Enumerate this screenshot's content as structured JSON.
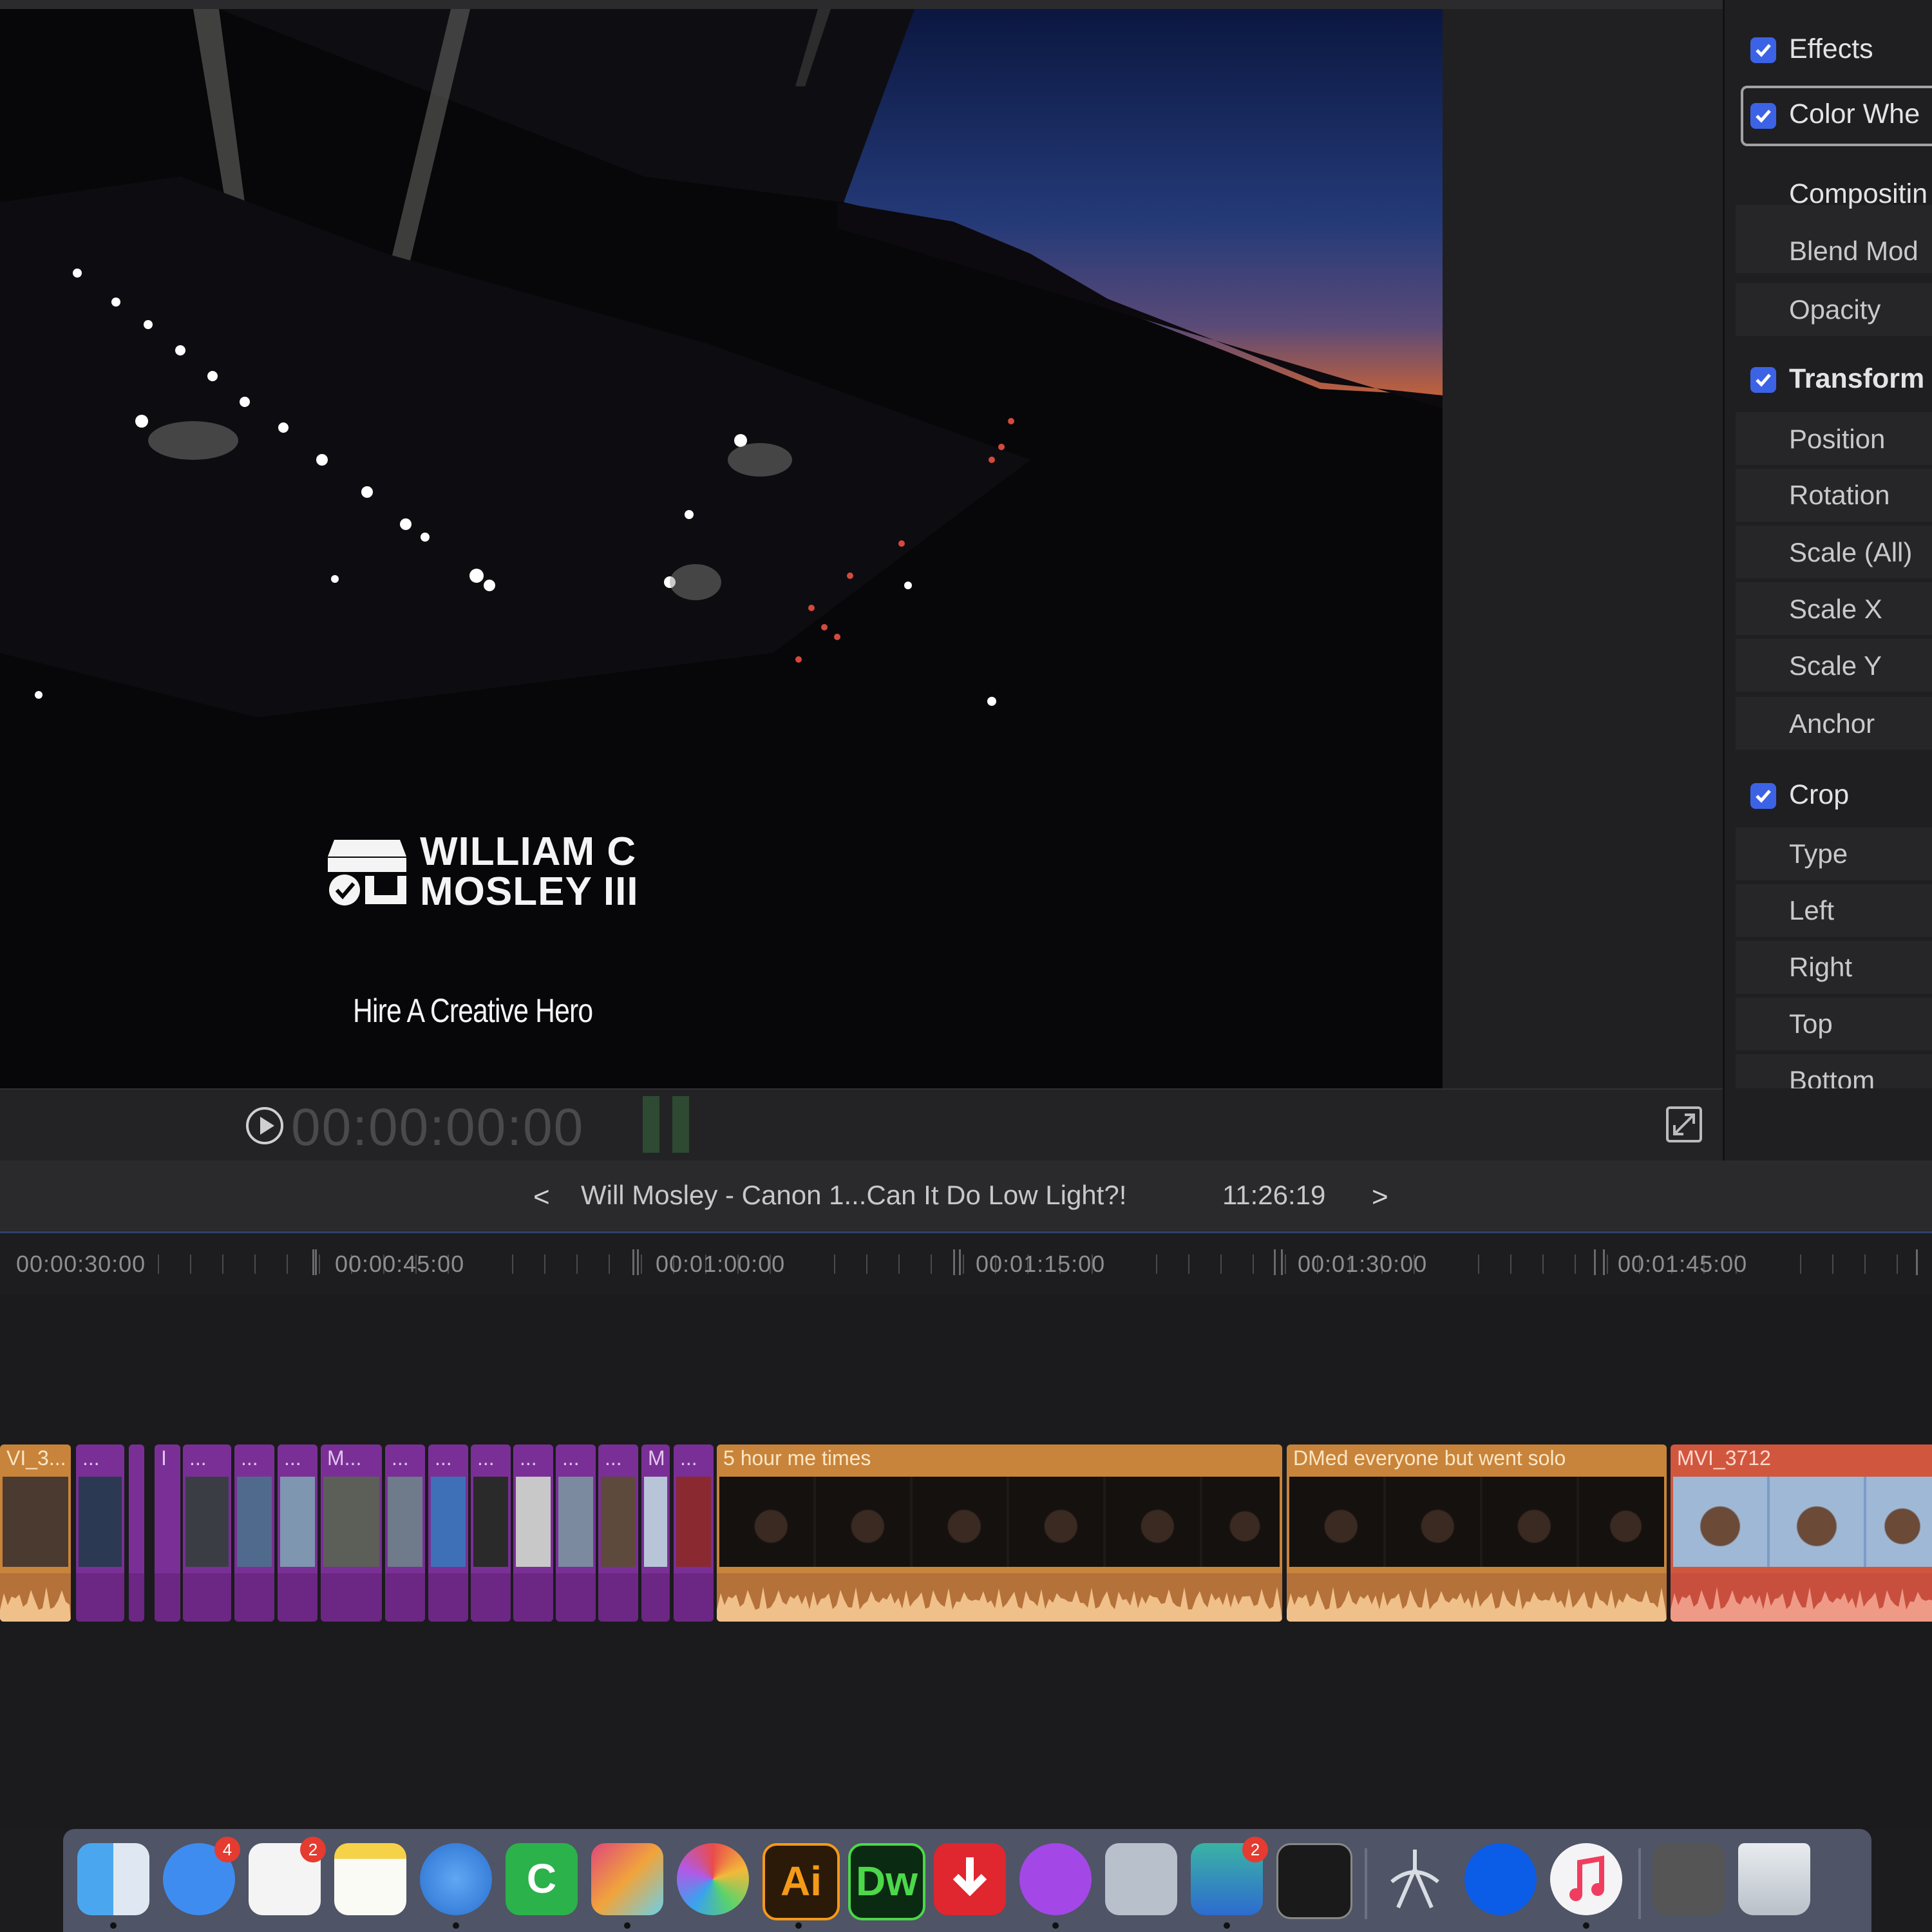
{
  "viewer": {
    "watermark": {
      "name": "WILLIAM C\nMOSLEY III",
      "tagline": "Hire A Creative Hero"
    },
    "timecode": "00:00:00:00"
  },
  "inspector": {
    "sections": [
      {
        "label": "Effects",
        "checked": true
      },
      {
        "label": "Color Whe",
        "checked": true
      },
      {
        "label": "Compositin"
      },
      {
        "label": "Blend Mod"
      },
      {
        "label": "Opacity"
      },
      {
        "label": "Transform",
        "checked": true
      },
      {
        "label": "Position"
      },
      {
        "label": "Rotation"
      },
      {
        "label": "Scale (All)"
      },
      {
        "label": "Scale X"
      },
      {
        "label": "Scale Y"
      },
      {
        "label": "Anchor"
      },
      {
        "label": "Crop",
        "checked": true
      },
      {
        "label": "Type"
      },
      {
        "label": "Left"
      },
      {
        "label": "Right"
      },
      {
        "label": "Top"
      },
      {
        "label": "Bottom"
      }
    ]
  },
  "timeline": {
    "prev": "<",
    "project": "Will Mosley - Canon 1...Can It Do Low Light?!",
    "duration": "11:26:19",
    "next": ">",
    "ruler": [
      "00:00:30:00",
      "00:00:45:00",
      "00:01:00:00",
      "00:01:15:00",
      "00:01:30:00",
      "00:01:45:00"
    ],
    "clips": [
      {
        "title": "VI_3...",
        "color": "orange"
      },
      {
        "title": "...",
        "color": "purple"
      },
      {
        "title": "",
        "color": "purple"
      },
      {
        "title": "I",
        "color": "purple"
      },
      {
        "title": "...",
        "color": "purple"
      },
      {
        "title": "...",
        "color": "purple"
      },
      {
        "title": "...",
        "color": "purple"
      },
      {
        "title": "M...",
        "color": "purple"
      },
      {
        "title": "...",
        "color": "purple"
      },
      {
        "title": "...",
        "color": "purple"
      },
      {
        "title": "...",
        "color": "purple"
      },
      {
        "title": "...",
        "color": "purple"
      },
      {
        "title": "...",
        "color": "purple"
      },
      {
        "title": "...",
        "color": "purple"
      },
      {
        "title": "M",
        "color": "purple"
      },
      {
        "title": "...",
        "color": "purple"
      },
      {
        "title": "5 hour me times",
        "color": "orange"
      },
      {
        "title": "DMed everyone but went solo",
        "color": "orange"
      },
      {
        "title": "MVI_3712",
        "color": "red"
      }
    ]
  },
  "dock": {
    "apps": [
      {
        "name": "finder-icon"
      },
      {
        "name": "messages-icon",
        "badge": "4"
      },
      {
        "name": "reminders-icon",
        "badge": "2"
      },
      {
        "name": "notes-icon"
      },
      {
        "name": "safari-icon"
      },
      {
        "name": "camtasia-icon",
        "glyph": "C"
      },
      {
        "name": "final-cut-pro-icon"
      },
      {
        "name": "motion-icon"
      },
      {
        "name": "illustrator-icon",
        "glyph": "Ai"
      },
      {
        "name": "dreamweaver-icon",
        "glyph": "Dw"
      },
      {
        "name": "downloader-icon"
      },
      {
        "name": "podcasts-icon"
      },
      {
        "name": "screenshot-icon"
      },
      {
        "name": "shield-icon",
        "badge": "2"
      },
      {
        "name": "terminal-icon"
      },
      {
        "name": "automator-icon"
      },
      {
        "name": "dropbox-icon"
      },
      {
        "name": "music-icon"
      },
      {
        "name": "scanner-icon"
      },
      {
        "name": "trash-icon"
      }
    ]
  },
  "colors": {
    "checkbox": "#3c63e6",
    "purple_clip": "#7a2f96",
    "orange_clip": "#c8843a",
    "red_clip": "#d0573e"
  }
}
